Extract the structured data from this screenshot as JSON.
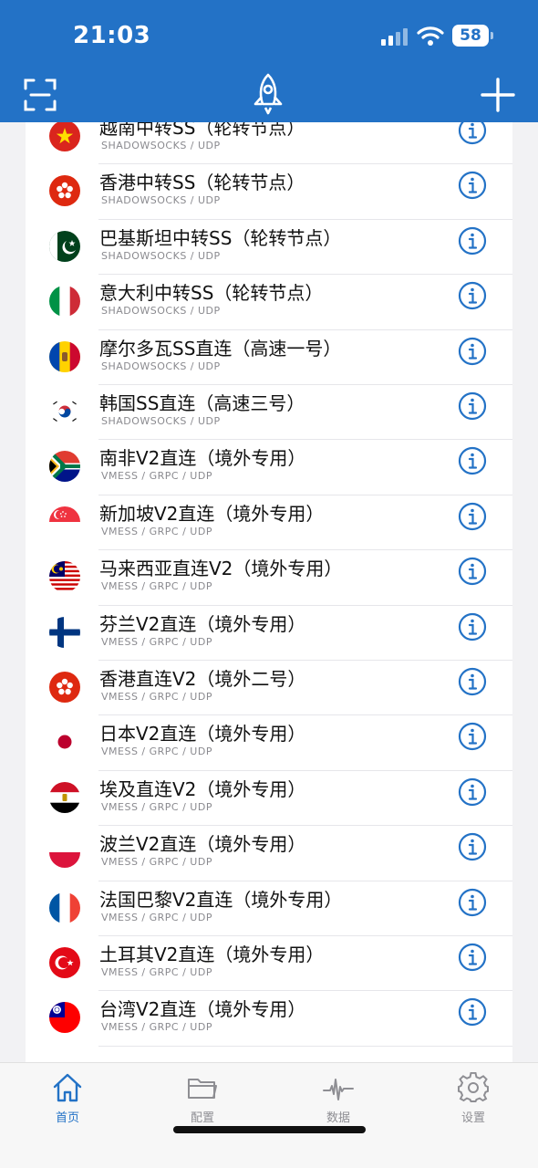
{
  "status_bar": {
    "time": "21:03",
    "battery": "58"
  },
  "header": {
    "scan_icon": "scan-qr-icon",
    "logo_icon": "rocket-icon",
    "add_icon": "plus-icon"
  },
  "servers": [
    {
      "name": "越南中转SS（轮转节点）",
      "protocol": "SHADOWSOCKS / UDP",
      "flag": "vietnam"
    },
    {
      "name": "香港中转SS（轮转节点）",
      "protocol": "SHADOWSOCKS / UDP",
      "flag": "hongkong"
    },
    {
      "name": "巴基斯坦中转SS（轮转节点）",
      "protocol": "SHADOWSOCKS / UDP",
      "flag": "pakistan"
    },
    {
      "name": "意大利中转SS（轮转节点）",
      "protocol": "SHADOWSOCKS / UDP",
      "flag": "italy"
    },
    {
      "name": "摩尔多瓦SS直连（高速一号）",
      "protocol": "SHADOWSOCKS / UDP",
      "flag": "moldova"
    },
    {
      "name": "韩国SS直连（高速三号）",
      "protocol": "SHADOWSOCKS / UDP",
      "flag": "korea"
    },
    {
      "name": "南非V2直连（境外专用）",
      "protocol": "VMESS / GRPC / UDP",
      "flag": "southafrica"
    },
    {
      "name": "新加坡V2直连（境外专用）",
      "protocol": "VMESS / GRPC / UDP",
      "flag": "singapore"
    },
    {
      "name": "马来西亚直连V2（境外专用）",
      "protocol": "VMESS / GRPC / UDP",
      "flag": "malaysia"
    },
    {
      "name": "芬兰V2直连（境外专用）",
      "protocol": "VMESS / GRPC / UDP",
      "flag": "finland"
    },
    {
      "name": "香港直连V2（境外二号）",
      "protocol": "VMESS / GRPC / UDP",
      "flag": "hongkong"
    },
    {
      "name": "日本V2直连（境外专用）",
      "protocol": "VMESS / GRPC / UDP",
      "flag": "japan"
    },
    {
      "name": "埃及直连V2（境外专用）",
      "protocol": "VMESS / GRPC / UDP",
      "flag": "egypt"
    },
    {
      "name": "波兰V2直连（境外专用）",
      "protocol": "VMESS / GRPC / UDP",
      "flag": "poland"
    },
    {
      "name": "法国巴黎V2直连（境外专用）",
      "protocol": "VMESS / GRPC / UDP",
      "flag": "france"
    },
    {
      "name": "土耳其V2直连（境外专用）",
      "protocol": "VMESS / GRPC / UDP",
      "flag": "turkey"
    },
    {
      "name": "台湾V2直连（境外专用）",
      "protocol": "VMESS / GRPC / UDP",
      "flag": "taiwan"
    }
  ],
  "tabs": [
    {
      "label": "首页",
      "icon": "home-icon",
      "active": true
    },
    {
      "label": "配置",
      "icon": "folder-icon",
      "active": false
    },
    {
      "label": "数据",
      "icon": "activity-icon",
      "active": false
    },
    {
      "label": "设置",
      "icon": "gear-icon",
      "active": false
    }
  ],
  "colors": {
    "accent": "#2372c6",
    "background": "#f2f2f4",
    "tab_inactive": "#8e8e93"
  }
}
